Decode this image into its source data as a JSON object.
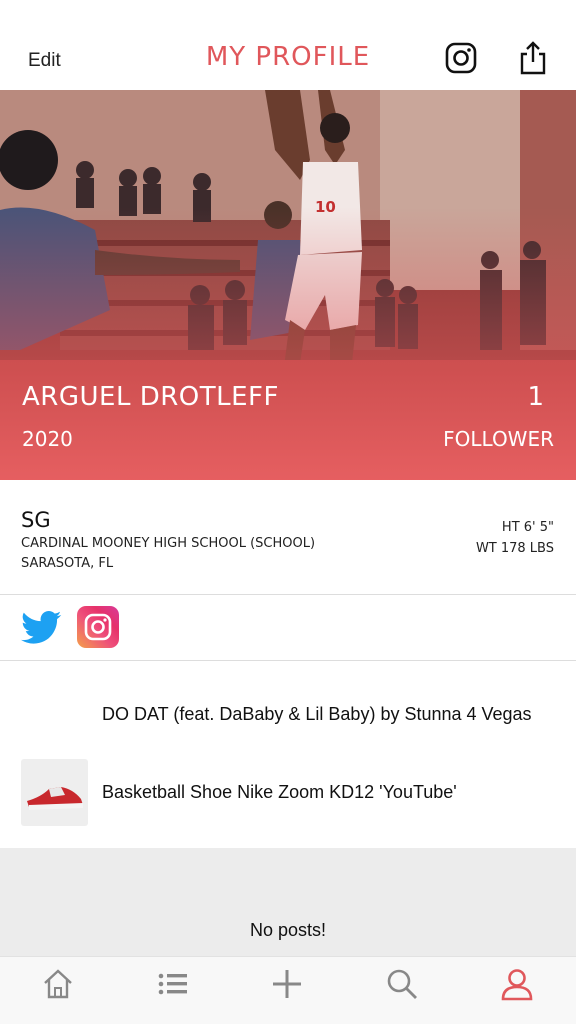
{
  "header": {
    "edit_label": "Edit",
    "title": "MY PROFILE",
    "instagram_icon": "instagram-icon",
    "share_icon": "share-icon"
  },
  "profile": {
    "name": "ARGUEL DROTLEFF",
    "class_year": "2020",
    "follower_count": "1",
    "follower_label": "FOLLOWER",
    "position": "SG",
    "school": "CARDINAL MOONEY HIGH SCHOOL (SCHOOL)",
    "location": "SARASOTA, FL",
    "height": "HT 6' 5\"",
    "weight": "WT 178 LBS"
  },
  "social": {
    "twitter_icon": "twitter-icon",
    "instagram_icon": "instagram-icon"
  },
  "media": {
    "song": "DO DAT (feat. DaBaby & Lil Baby) by Stunna 4 Vegas",
    "shoe": "Basketball Shoe Nike Zoom KD12 'YouTube'"
  },
  "posts": {
    "empty_text": "No posts!"
  },
  "tabbar": {
    "items": [
      "home-icon",
      "list-icon",
      "add-icon",
      "search-icon",
      "profile-icon"
    ],
    "active_color": "#e0575b",
    "inactive_color": "#888888"
  },
  "colors": {
    "accent": "#e0575b",
    "twitter": "#1da1f2"
  }
}
